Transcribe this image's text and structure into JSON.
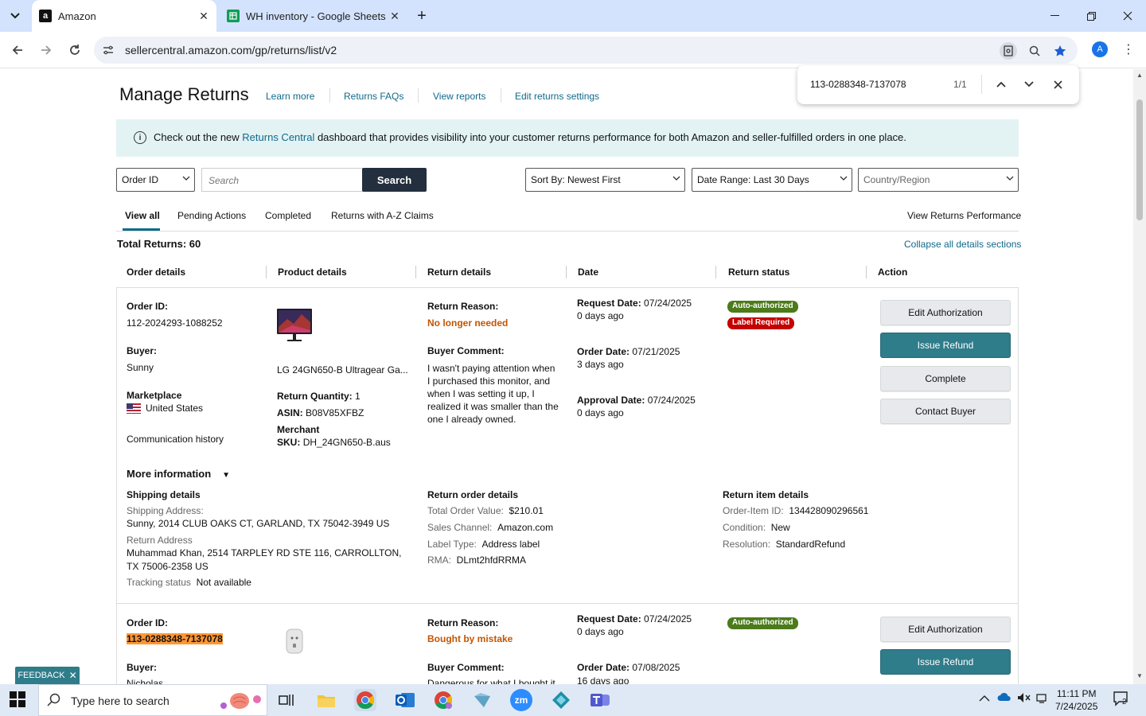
{
  "browser": {
    "tabs": [
      {
        "title": "Amazon",
        "favicon": "amazon-icon",
        "active": true
      },
      {
        "title": "WH inventory - Google Sheets",
        "favicon": "sheets-icon",
        "active": false
      }
    ],
    "url": "sellercentral.amazon.com/gp/returns/list/v2",
    "profile_initial": "A"
  },
  "find_bar": {
    "query": "113-0288348-7137078",
    "count": "1/1"
  },
  "header": {
    "title": "Manage Returns",
    "links": [
      "Learn more",
      "Returns FAQs",
      "View reports",
      "Edit returns settings"
    ]
  },
  "banner": {
    "prefix": "Check out the new ",
    "link": "Returns Central",
    "suffix": " dashboard that provides visibility into your customer returns performance for both Amazon and seller-fulfilled orders in one place."
  },
  "filters": {
    "search_type": "Order ID",
    "search_placeholder": "Search",
    "search_button": "Search",
    "sort": "Sort By: Newest First",
    "date_range": "Date Range: Last 30 Days",
    "country": "Country/Region"
  },
  "tabs": {
    "items": [
      "View all",
      "Pending Actions",
      "Completed",
      "Returns with A-Z Claims"
    ],
    "performance_link": "View Returns Performance"
  },
  "summary": {
    "total": "Total Returns: 60",
    "collapse": "Collapse all details sections"
  },
  "columns": [
    "Order details",
    "Product details",
    "Return details",
    "Date",
    "Return status",
    "Action"
  ],
  "returns": [
    {
      "order_id_label": "Order ID:",
      "order_id": "112-2024293-1088252",
      "buyer_label": "Buyer:",
      "buyer": "Sunny",
      "marketplace_label": "Marketplace",
      "marketplace": "United States",
      "comm_history": "Communication history",
      "product_name": "LG 24GN650-B Ultragear Ga...",
      "return_qty_label": "Return Quantity:",
      "return_qty": "1",
      "asin_label": "ASIN:",
      "asin": "B08V85XFBZ",
      "merchant_label": "Merchant",
      "sku_label": "SKU:",
      "sku": "DH_24GN650-B.aus",
      "return_reason_label": "Return Reason:",
      "return_reason": "No longer needed",
      "buyer_comment_label": "Buyer Comment:",
      "buyer_comment": "I wasn't paying attention when I purchased this monitor, and when I was setting it up, I realized it was smaller than the one I already owned.",
      "request_date_label": "Request Date:",
      "request_date": "07/24/2025",
      "request_ago": "0 days ago",
      "order_date_label": "Order Date:",
      "order_date": "07/21/2025",
      "order_ago": "3 days ago",
      "approval_date_label": "Approval Date:",
      "approval_date": "07/24/2025",
      "approval_ago": "0 days ago",
      "status_badges": [
        "Auto-authorized",
        "Label Required"
      ],
      "actions": [
        "Edit Authorization",
        "Issue Refund",
        "Complete",
        "Contact Buyer"
      ],
      "more_info": "More information",
      "shipping": {
        "title": "Shipping details",
        "address_label": "Shipping Address:",
        "address": "Sunny, 2014 CLUB OAKS CT, GARLAND, TX 75042-3949 US",
        "return_address_label": "Return Address",
        "return_address_line1": "Muhammad Khan, 2514 TARPLEY RD STE 116, CARROLLTON,",
        "return_address_line2": "TX 75006-2358 US",
        "tracking_label": "Tracking status",
        "tracking": "Not available"
      },
      "return_order": {
        "title": "Return order details",
        "total_label": "Total Order Value:",
        "total": "$210.01",
        "channel_label": "Sales Channel:",
        "channel": "Amazon.com",
        "label_type_label": "Label Type:",
        "label_type": "Address label",
        "rma_label": "RMA:",
        "rma": "DLmt2hfdRRMA"
      },
      "return_item": {
        "title": "Return item details",
        "order_item_label": "Order-Item ID:",
        "order_item": "134428090296561",
        "condition_label": "Condition:",
        "condition": "New",
        "resolution_label": "Resolution:",
        "resolution": "StandardRefund"
      }
    },
    {
      "order_id_label": "Order ID:",
      "order_id": "113-0288348-7137078",
      "buyer_label": "Buyer:",
      "buyer": "Nicholas",
      "return_reason_label": "Return Reason:",
      "return_reason": "Bought by mistake",
      "buyer_comment_label": "Buyer Comment:",
      "buyer_comment": "Dangerous for what I bought it",
      "request_date_label": "Request Date:",
      "request_date": "07/24/2025",
      "request_ago": "0 days ago",
      "order_date_label": "Order Date:",
      "order_date": "07/08/2025",
      "order_ago": "16 days ago",
      "status_badges": [
        "Auto-authorized"
      ],
      "actions": [
        "Edit Authorization",
        "Issue Refund"
      ]
    }
  ],
  "feedback": "FEEDBACK",
  "taskbar": {
    "search_placeholder": "Type here to search",
    "time": "11:11 PM",
    "date": "7/24/2025",
    "notification_count": "2"
  }
}
